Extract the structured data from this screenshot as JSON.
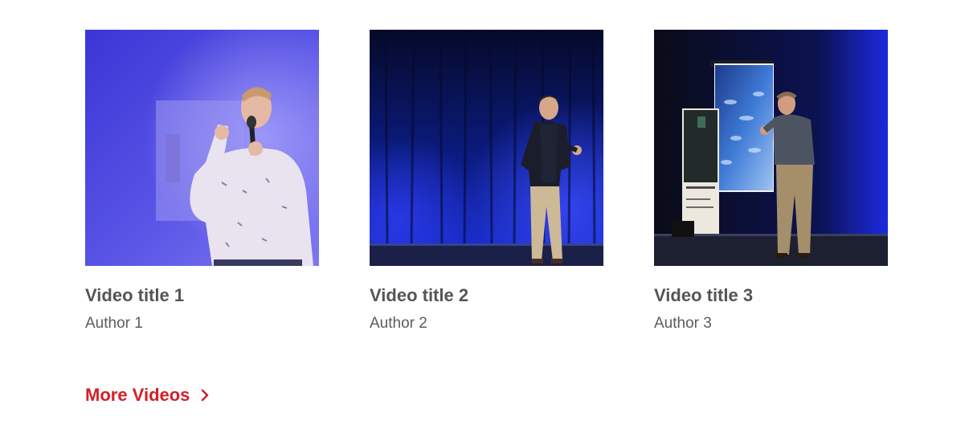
{
  "videos": [
    {
      "title": "Video title 1",
      "author": "Author 1"
    },
    {
      "title": "Video title 2",
      "author": "Author 2"
    },
    {
      "title": "Video title 3",
      "author": "Author 3"
    }
  ],
  "more_link": {
    "label": "More Videos",
    "icon": "chevron-right-icon"
  },
  "colors": {
    "accent": "#d32027",
    "title": "#555555",
    "author": "#5c5c5c"
  }
}
